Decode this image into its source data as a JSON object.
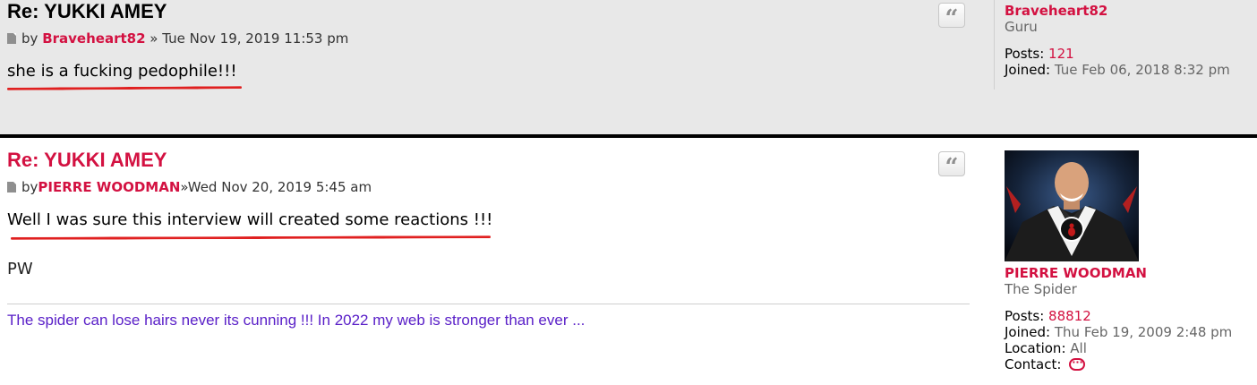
{
  "posts": [
    {
      "title": "Re: YUKKI AMEY",
      "by": "by",
      "author": "Braveheart82",
      "sep": " » ",
      "timestamp": "Tue Nov 19, 2019 11:53 pm",
      "content": "she is a fucking pedophile!!!",
      "quote_label": "“",
      "profile": {
        "name": "Braveheart82",
        "rank": "Guru",
        "posts_label": "Posts:",
        "posts": "121",
        "joined_label": "Joined:",
        "joined": "Tue Feb 06, 2018 8:32 pm"
      }
    },
    {
      "title": "Re: YUKKI AMEY",
      "by": "by",
      "author": "PIERRE WOODMAN",
      "sep": "»",
      "timestamp": "Wed Nov 20, 2019 5:45 am",
      "content": "Well I was sure this interview will created some reactions !!!",
      "content2": "PW",
      "signature": "The spider can lose hairs never its cunning !!! In 2022 my web is stronger than ever ...",
      "quote_label": "“",
      "profile": {
        "name": "PIERRE WOODMAN",
        "rank": "The Spider",
        "posts_label": "Posts:",
        "posts": "88812",
        "joined_label": "Joined:",
        "joined": "Thu Feb 19, 2009 2:48 pm",
        "location_label": "Location:",
        "location": "All",
        "contact_label": "Contact:"
      }
    }
  ],
  "colors": {
    "accent": "#d31141",
    "signature": "#5a20c8",
    "annotation": "#e02020",
    "post1_bg": "#e8e8e8"
  }
}
